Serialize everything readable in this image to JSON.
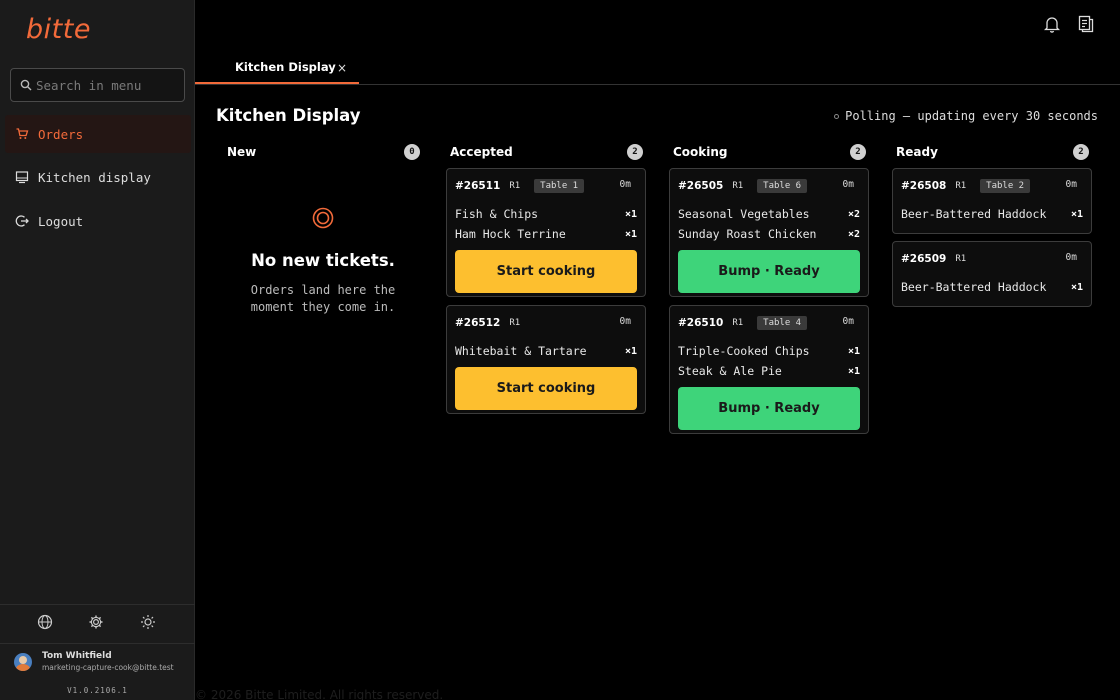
{
  "brand": {
    "logo_text": "bitte",
    "accent_color": "#f26a3a"
  },
  "search": {
    "placeholder": "Search in menu"
  },
  "sidebar": {
    "items": [
      {
        "label": "Orders",
        "icon": "cart-icon",
        "active": true
      },
      {
        "label": "Kitchen display",
        "icon": "monitor-icon",
        "active": false
      },
      {
        "label": "Logout",
        "icon": "logout-icon",
        "active": false
      }
    ],
    "footer_icons": [
      "globe-icon",
      "gear-icon",
      "sun-icon"
    ],
    "user": {
      "name": "Tom Whitfield",
      "email": "marketing-capture-cook@bitte.test"
    },
    "version": "V1.0.2106.1"
  },
  "header": {
    "icons": [
      "bell-icon",
      "document-icon"
    ]
  },
  "tabs": [
    {
      "label": "Kitchen Display",
      "close": "×"
    }
  ],
  "page": {
    "title": "Kitchen Display",
    "polling_text": "Polling — updating every 30 seconds"
  },
  "columns": [
    {
      "title": "New",
      "count": "0",
      "empty": {
        "title": "No new tickets.",
        "text": "Orders land here the moment they come in."
      }
    },
    {
      "title": "Accepted",
      "count": "2"
    },
    {
      "title": "Cooking",
      "count": "2"
    },
    {
      "title": "Ready",
      "count": "2"
    }
  ],
  "tickets": {
    "t26511": {
      "number": "#26511",
      "rev": "R1",
      "table": "Table 1",
      "age": "0m",
      "items": [
        {
          "name": "Fish & Chips",
          "qty": "×1"
        },
        {
          "name": "Ham Hock Terrine",
          "qty": "×1"
        }
      ],
      "action": "Start cooking"
    },
    "t26512": {
      "number": "#26512",
      "rev": "R1",
      "age": "0m",
      "items": [
        {
          "name": "Whitebait & Tartare",
          "qty": "×1"
        }
      ],
      "action": "Start cooking"
    },
    "t26505": {
      "number": "#26505",
      "rev": "R1",
      "table": "Table 6",
      "age": "0m",
      "items": [
        {
          "name": "Seasonal Vegetables",
          "qty": "×2"
        },
        {
          "name": "Sunday Roast Chicken",
          "qty": "×2"
        }
      ],
      "action": "Bump · Ready"
    },
    "t26510": {
      "number": "#26510",
      "rev": "R1",
      "table": "Table 4",
      "age": "0m",
      "items": [
        {
          "name": "Triple-Cooked Chips",
          "qty": "×1"
        },
        {
          "name": "Steak & Ale Pie",
          "qty": "×1"
        }
      ],
      "action": "Bump · Ready"
    },
    "t26508": {
      "number": "#26508",
      "rev": "R1",
      "table": "Table 2",
      "age": "0m",
      "items": [
        {
          "name": "Beer-Battered Haddock",
          "qty": "×1"
        }
      ]
    },
    "t26509": {
      "number": "#26509",
      "rev": "R1",
      "age": "0m",
      "items": [
        {
          "name": "Beer-Battered Haddock",
          "qty": "×1"
        }
      ]
    }
  },
  "colors": {
    "start_button": "#fdbf2f",
    "bump_button": "#3ed47a"
  },
  "footer": {
    "copyright": "© 2026 Bitte Limited. All rights reserved."
  }
}
